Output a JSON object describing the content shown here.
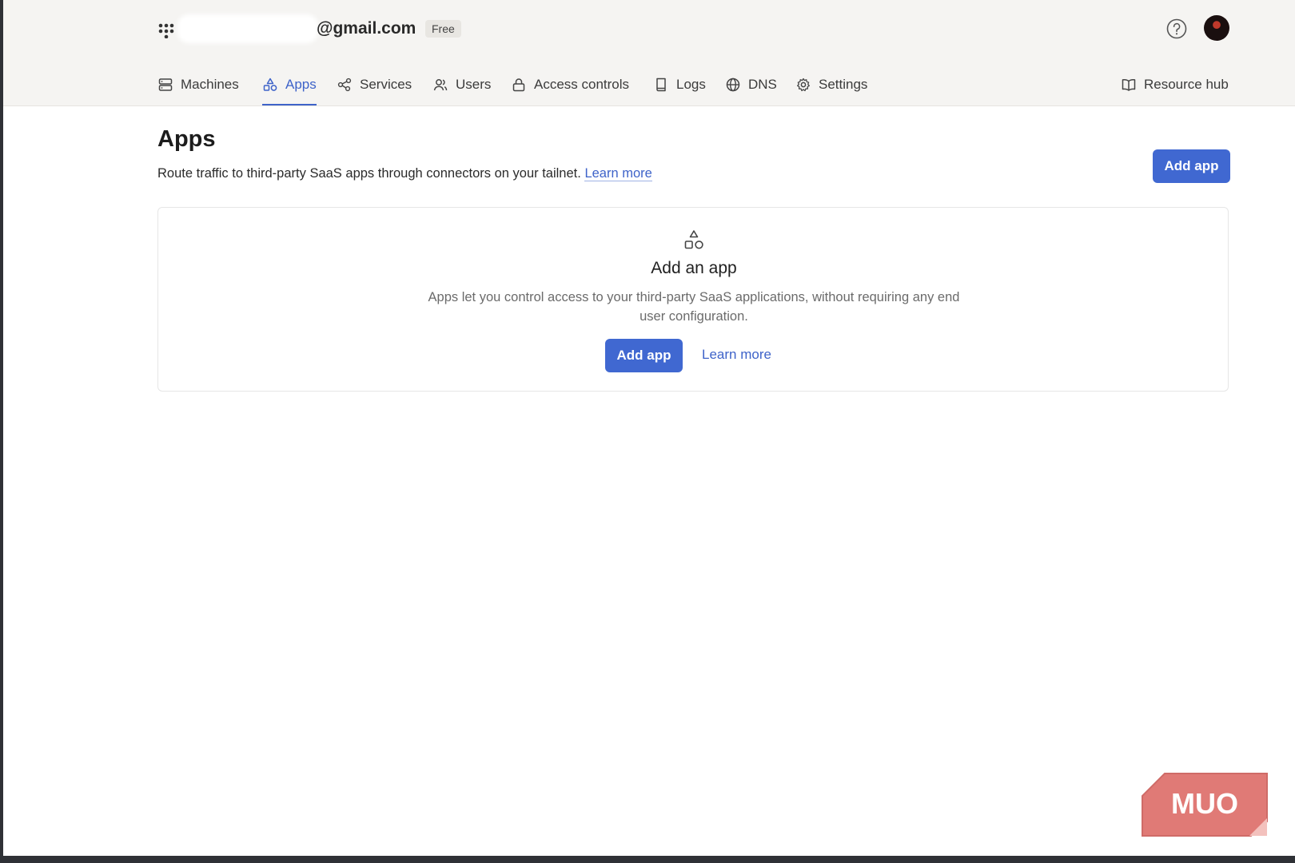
{
  "header": {
    "account_email": "@gmail.com",
    "plan_badge": "Free"
  },
  "nav": {
    "tabs": [
      {
        "label": "Machines",
        "icon": "server-icon",
        "active": false
      },
      {
        "label": "Apps",
        "icon": "shapes-icon",
        "active": true
      },
      {
        "label": "Services",
        "icon": "services-icon",
        "active": false
      },
      {
        "label": "Users",
        "icon": "users-icon",
        "active": false
      },
      {
        "label": "Access controls",
        "icon": "lock-icon",
        "active": false
      },
      {
        "label": "Logs",
        "icon": "book-icon",
        "active": false
      },
      {
        "label": "DNS",
        "icon": "globe-icon",
        "active": false
      },
      {
        "label": "Settings",
        "icon": "gear-icon",
        "active": false
      }
    ],
    "resource_hub": "Resource hub"
  },
  "page": {
    "title": "Apps",
    "subtitle": "Route traffic to third-party SaaS apps through connectors on your tailnet.",
    "subtitle_link": "Learn more",
    "add_button": "Add app"
  },
  "empty_state": {
    "icon": "shapes-icon",
    "title": "Add an app",
    "description": "Apps let you control access to your third-party SaaS applications, without requiring any end user configuration.",
    "primary_button": "Add app",
    "secondary_link": "Learn more"
  },
  "watermark": {
    "text": "MUO"
  },
  "colors": {
    "accent": "#4068d1",
    "link": "#3e63c9",
    "header_bg": "#f5f4f2",
    "watermark_bg": "#e07a76"
  }
}
